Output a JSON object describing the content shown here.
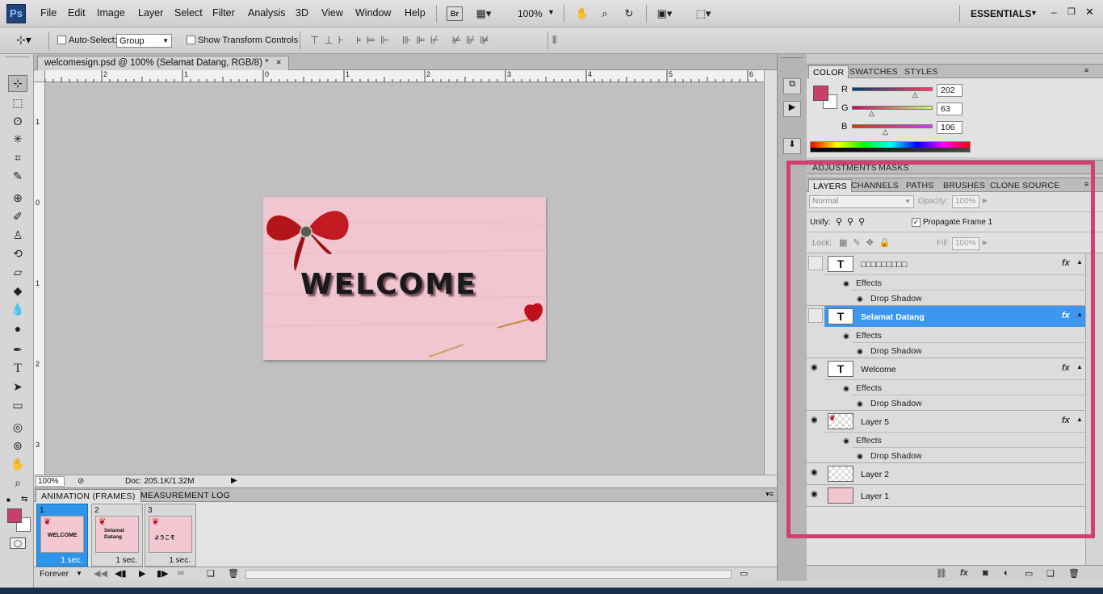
{
  "app": {
    "logo": "Ps",
    "workspace": "ESSENTIALS"
  },
  "menu": [
    "File",
    "Edit",
    "Image",
    "Layer",
    "Select",
    "Filter",
    "Analysis",
    "3D",
    "View",
    "Window",
    "Help"
  ],
  "toolbar": {
    "bridge": "Br",
    "zoom": "100%"
  },
  "options": {
    "auto_select_label": "Auto-Select:",
    "auto_select_value": "Group",
    "transform_label": "Show Transform Controls"
  },
  "document": {
    "tab_title": "welcomesign.psd @ 100% (Selamat Datang, RGB/8) *",
    "close": "×",
    "canvas_text": "WELCOME",
    "h_ruler_labels": [
      "2",
      "1",
      "0",
      "1",
      "2",
      "3",
      "4",
      "5",
      "6"
    ],
    "v_ruler_labels": [
      "1",
      "0",
      "1",
      "2",
      "3"
    ]
  },
  "status": {
    "zoom": "100%",
    "doc": "Doc: 205.1K/1.32M"
  },
  "animation": {
    "tabs": [
      "ANIMATION (FRAMES)",
      "MEASUREMENT LOG"
    ],
    "frames": [
      {
        "num": "1",
        "delay": "1 sec.",
        "thumb": "WELCOME"
      },
      {
        "num": "2",
        "delay": "1 sec.",
        "thumb": "Selamat Datang"
      },
      {
        "num": "3",
        "delay": "1 sec.",
        "thumb": "ようこそ"
      }
    ],
    "loop": "Forever"
  },
  "color_panel": {
    "tabs": [
      "COLOR",
      "SWATCHES",
      "STYLES"
    ],
    "r_label": "R",
    "g_label": "G",
    "b_label": "B",
    "r": "202",
    "g": "63",
    "b": "106",
    "r_frac": 0.79,
    "g_frac": 0.25,
    "b_frac": 0.42,
    "fg": "#ca3f6a"
  },
  "adjust_tabs": [
    "ADJUSTMENTS",
    "MASKS"
  ],
  "layers_panel": {
    "tabs": [
      "LAYERS",
      "CHANNELS",
      "PATHS",
      "BRUSHES",
      "CLONE SOURCE"
    ],
    "blend_mode": "Normal",
    "opacity_label": "Opacity:",
    "opacity": "100%",
    "unify_label": "Unify:",
    "propagate_label": "Propagate Frame 1",
    "lock_label": "Lock:",
    "fill_label": "Fill:",
    "fill": "100%",
    "effects_label": "Effects",
    "drop_shadow_label": "Drop Shadow",
    "fx_label": "fx",
    "layers": [
      {
        "name": "□□□□□□□□□",
        "type": "text",
        "visible": false,
        "selected": false,
        "effects": true
      },
      {
        "name": "Selamat Datang",
        "type": "text",
        "visible": false,
        "selected": true,
        "effects": true
      },
      {
        "name": "Welcome",
        "type": "text",
        "visible": true,
        "selected": false,
        "effects": true
      },
      {
        "name": "Layer 5",
        "type": "image",
        "visible": true,
        "selected": false,
        "effects": true
      },
      {
        "name": "Layer 2",
        "type": "image",
        "visible": true,
        "selected": false,
        "effects": false
      },
      {
        "name": "Layer 1",
        "type": "image",
        "visible": true,
        "selected": false,
        "effects": false
      }
    ],
    "thumb_text_glyph": "T"
  },
  "colors": {
    "accent_blue": "#3d97f0",
    "highlight_pink": "#d23f74",
    "canvas_pink": "#f2c6d1"
  }
}
